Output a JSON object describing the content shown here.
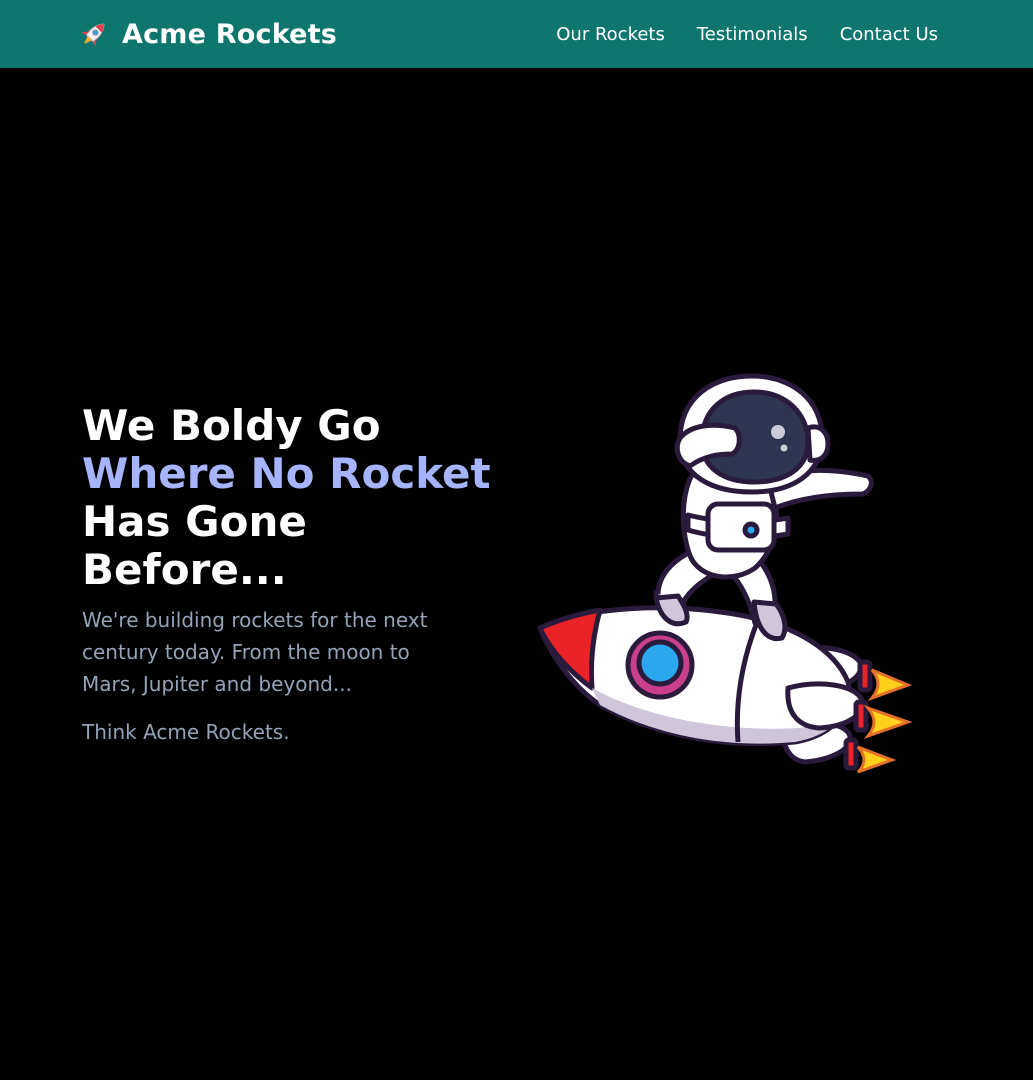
{
  "header": {
    "brand_name": "Acme Rockets",
    "brand_icon": "rocket-icon",
    "nav": [
      {
        "label": "Our Rockets"
      },
      {
        "label": "Testimonials"
      },
      {
        "label": "Contact Us"
      }
    ]
  },
  "hero": {
    "headline_line1": "We Boldy Go",
    "headline_accent": "Where No Rocket",
    "headline_line3": "Has Gone",
    "headline_line4": "Before...",
    "subtitle": "We're building rockets for the next century today. From the moon to Mars, Jupiter and beyond...",
    "tagline": "Think Acme Rockets.",
    "illustration": "astronaut-on-rocket-illustration"
  },
  "colors": {
    "header_bg": "#0f766e",
    "page_bg": "#000000",
    "accent": "#a5b4fc",
    "muted_text": "#94a3b8"
  }
}
